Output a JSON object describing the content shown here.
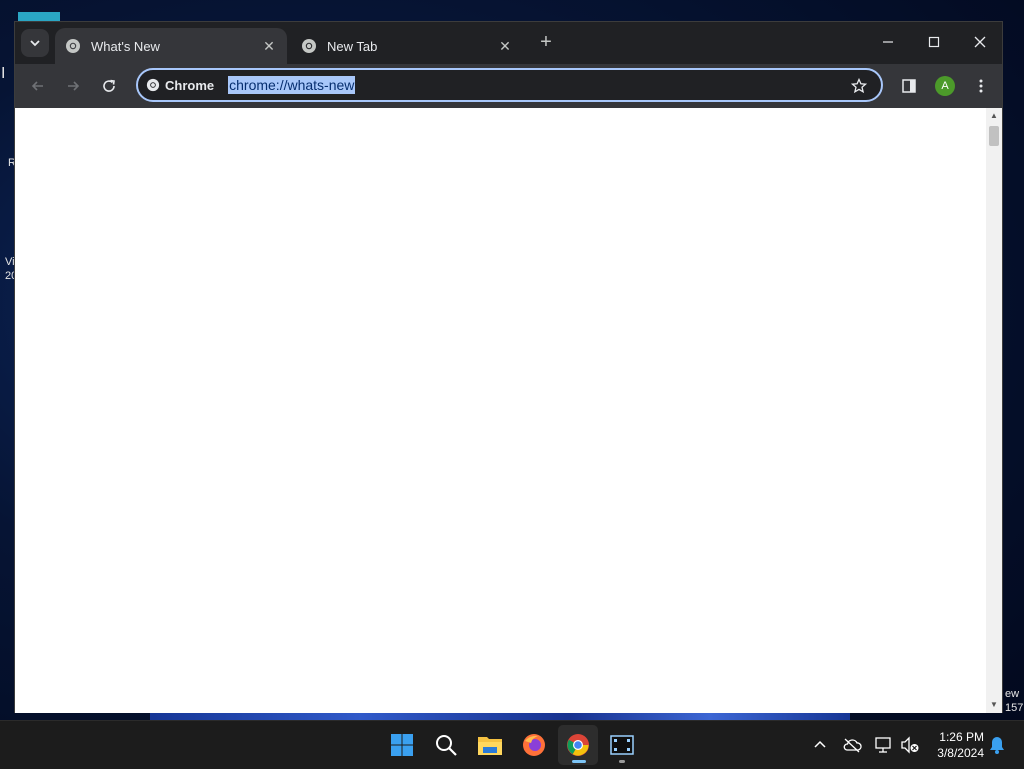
{
  "desktop": {
    "fragments": [
      "R",
      "Vi",
      "20",
      "ew",
      "157"
    ]
  },
  "browser": {
    "tabs": [
      {
        "title": "What's New",
        "active": true
      },
      {
        "title": "New Tab",
        "active": false
      }
    ],
    "omnibox": {
      "chip_label": "Chrome",
      "url": "chrome://whats-new"
    },
    "profile_initial": "A"
  },
  "taskbar": {
    "apps": [
      "start-icon",
      "search-icon",
      "file-explorer-icon",
      "firefox-icon",
      "chrome-icon",
      "media-player-icon"
    ],
    "clock": {
      "time": "1:26 PM",
      "date": "3/8/2024"
    }
  },
  "colors": {
    "accent": "#a8c7fa",
    "tab_active_bg": "#35363a",
    "frame_bg": "#202124",
    "profile_bg": "#4c9a2a"
  }
}
